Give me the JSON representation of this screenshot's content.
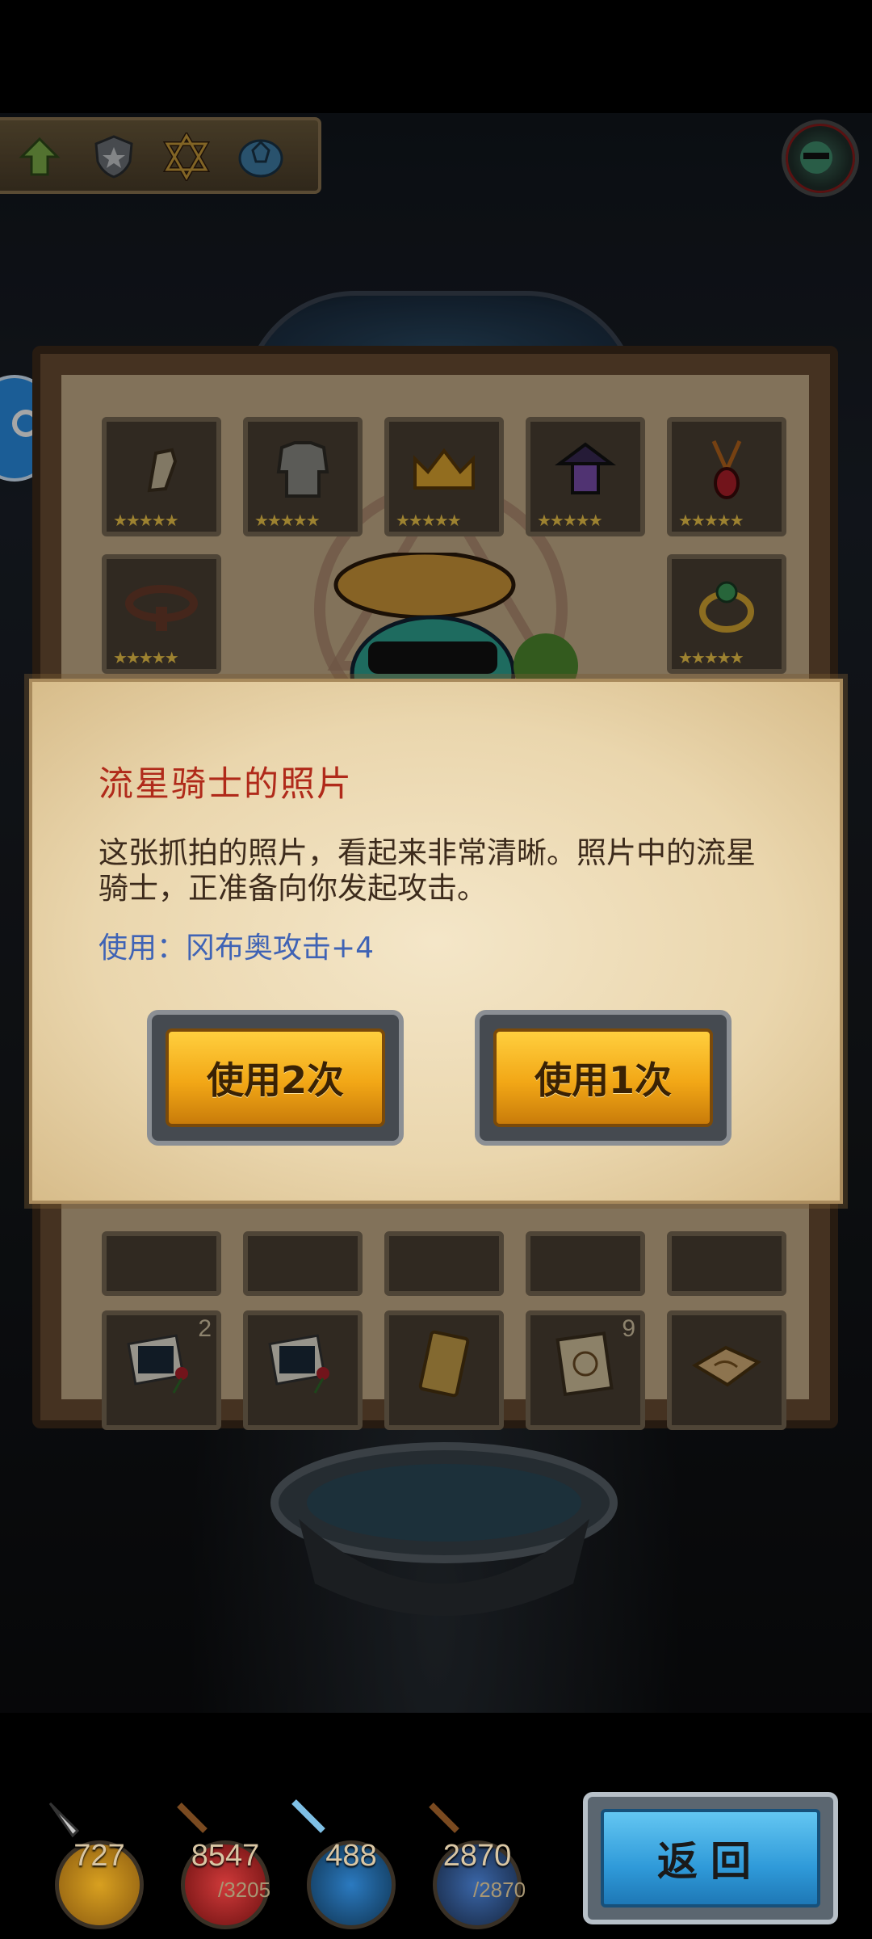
{
  "toolbar": {
    "icons": [
      "up-arrow-icon",
      "shield-star-icon",
      "hexagram-icon",
      "turtle-shell-icon"
    ]
  },
  "inventory": {
    "row1": [
      {
        "icon": "gauntlet-icon",
        "stars": "★★★★★"
      },
      {
        "icon": "chainmail-icon",
        "stars": "★★★★★"
      },
      {
        "icon": "crown-icon",
        "stars": "★★★★★"
      },
      {
        "icon": "lantern-icon",
        "stars": "★★★★★"
      },
      {
        "icon": "amulet-icon",
        "stars": "★★★★★"
      }
    ],
    "row2": [
      {
        "icon": "belt-icon",
        "stars": "★★★★★"
      },
      {
        "icon": "ring-icon",
        "stars": "★★★★★"
      }
    ],
    "bottom_row": [
      {
        "icon": "photo-rose-icon",
        "count": "2"
      },
      {
        "icon": "photo-rose-icon",
        "count": ""
      },
      {
        "icon": "golden-card-icon",
        "count": ""
      },
      {
        "icon": "scroll-map-icon",
        "count": "9"
      },
      {
        "icon": "open-book-icon",
        "count": ""
      }
    ]
  },
  "dialog": {
    "title": "流星骑士的照片",
    "description": "这张抓拍的照片，看起来非常清晰。照片中的流星骑士，正准备向你发起攻击。",
    "use_effect": "使用：冈布奥攻击+4",
    "use_twice_label": "使用2次",
    "use_once_label": "使用1次"
  },
  "hud": {
    "attack": "727",
    "hp": "8547",
    "hp_max": "/3205",
    "mana": "488",
    "defense": "2870",
    "defense_max": "/2870",
    "back_label": "返回"
  },
  "colors": {
    "title_red": "#b02a1a",
    "effect_blue": "#3f63b5",
    "gold_button": "#f2a716",
    "back_button": "#2f9ad9"
  }
}
